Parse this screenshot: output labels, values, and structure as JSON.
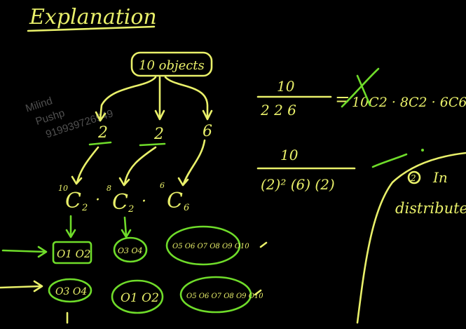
{
  "title": "Explanation",
  "objects_label": "10 objects",
  "groups": [
    "2",
    "2",
    "6"
  ],
  "combos": [
    {
      "n": "10",
      "k": "2"
    },
    {
      "n": "8",
      "k": "2"
    },
    {
      "n": "6",
      "k": "6"
    }
  ],
  "watermark": {
    "line1": "Milind",
    "line2": "Pushp",
    "line3": "919939726949"
  },
  "row1": [
    "O1 O2",
    "O3 O4",
    "O5 O6 O7 O8 O9 O10"
  ],
  "row2": [
    "O3 O4",
    "O1 O2",
    "O5 O6 O7 O8 O9 O10"
  ],
  "formula1": {
    "numerator": "10",
    "denominator": "2 2 6",
    "rhs": "10C2 · 8C2 · 6C6"
  },
  "formula2": {
    "numerator": "10",
    "denominator": "(2)² (6) (2)"
  },
  "note": {
    "number": "2",
    "word1": "In",
    "word2": "distribute"
  },
  "colors": {
    "yellow": "#e9f06a",
    "green": "#6fdc2a",
    "background": "#000000"
  }
}
